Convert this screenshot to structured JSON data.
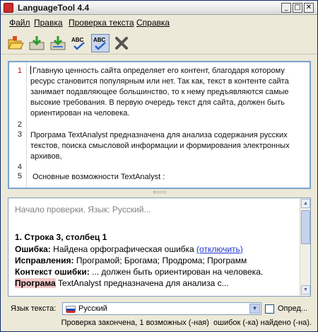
{
  "window": {
    "title": "LanguageTool 4.4",
    "controls": {
      "minimize": "_",
      "maximize": "□",
      "close": "✕"
    }
  },
  "menu": [
    "Файл",
    "Правка",
    "Проверка текста",
    "Справка"
  ],
  "toolbar": {
    "icons": [
      "open-folder-icon",
      "save-icon",
      "save-as-icon",
      "spellcheck-icon",
      "spellcheck-auto-icon",
      "close-icon"
    ]
  },
  "editor": {
    "line_numbers": [
      "1",
      "2",
      "3",
      "4",
      "5"
    ],
    "lines": [
      "Главную ценность сайта определяет его контент, благодаря которому",
      "ресурс становится популярным или нет. Так как, текст в контенте сайта",
      "занимает подавляющее большинство, то к нему предъявляются самые",
      "высокие требования. В первую очередь текст для сайта, должен быть",
      "ориентирован на человека.",
      "",
      "Програма TextAnalyst предназначена для анализа содержания русских",
      "текстов, поиска смысловой информации и формирования электронных",
      "архивов,",
      "",
      " Основные возможности TextAnalyst :"
    ]
  },
  "results": {
    "status_line": "Начало проверки. Язык: Русский...",
    "header": "1. Строка 3, столбец 1",
    "error_label": "Ошибка:",
    "error_text": " Найдена орфографическая ошибка ",
    "error_link": "(отключить)",
    "corrections_label": "Исправления:",
    "corrections_text": " Програмой; Брогама; Продрома; Программ",
    "context_label": "Контекст ошибки:",
    "context_text": " ... должен быть ориентирован на человека.",
    "context2_highlight": "Програма",
    "context2_text": " TextAnalyst предназначена для анализа с..."
  },
  "language": {
    "label": "Язык текста:",
    "selected": "Русский",
    "autodetect_label": "Опред..."
  },
  "status": "Проверка закончена, 1 возможных (-ная)  ошибок (-ка) найдено (-на).",
  "colors": {
    "line_number_highlight": "#d00000",
    "link": "#1f34d6",
    "error_highlight": "#f3c7c7"
  }
}
